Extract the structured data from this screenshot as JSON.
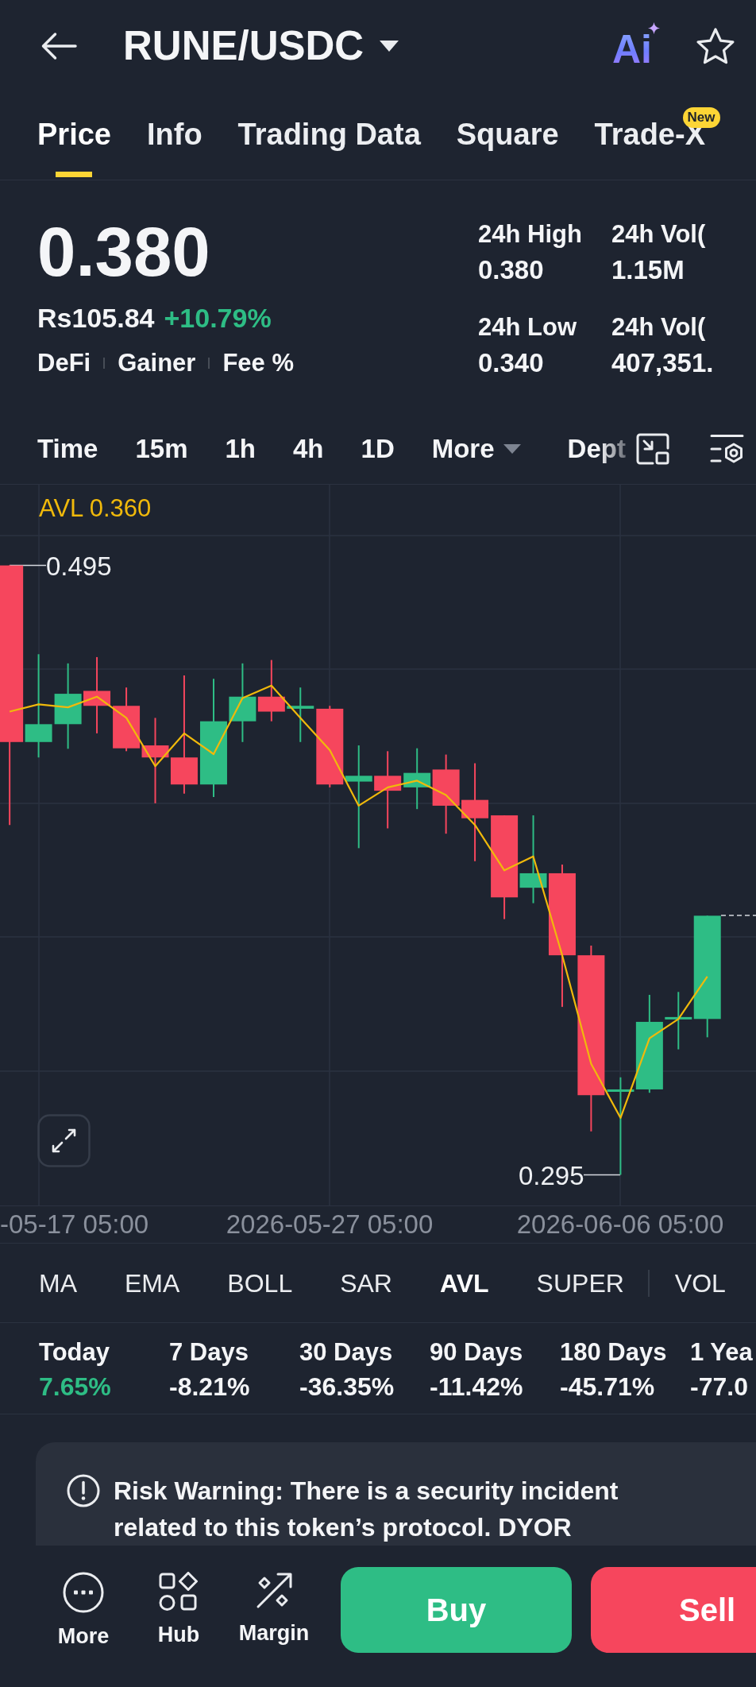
{
  "header": {
    "title": "RUNE/USDC",
    "ai_label": "Ai"
  },
  "tabs": [
    {
      "label": "Price",
      "selected": true
    },
    {
      "label": "Info",
      "selected": false
    },
    {
      "label": "Trading Data",
      "selected": false
    },
    {
      "label": "Square",
      "selected": false
    },
    {
      "label": "Trade-X",
      "selected": false,
      "badge": "New"
    }
  ],
  "price": {
    "last": "0.380",
    "fiat": "Rs105.84",
    "change": {
      "value": "+10.79%",
      "kind": "gain"
    },
    "tags": [
      "DeFi",
      "Gainer",
      "Fee %"
    ]
  },
  "stats": [
    {
      "label": "24h High",
      "value": "0.380"
    },
    {
      "label": "24h Vol(",
      "value": "1.15M"
    },
    {
      "label": "24h Low",
      "value": "0.340"
    },
    {
      "label": "24h Vol(",
      "value": "407,351."
    }
  ],
  "chart_toolbar": {
    "intervals": [
      "Time",
      "15m",
      "1h",
      "4h",
      "1D"
    ],
    "more": "More",
    "depth": "Dept"
  },
  "chart": {
    "avl_label": "AVL 0.360",
    "high_label": "0.495",
    "low_label": "0.295",
    "dates": [
      "-05-17 05:00",
      "2026-05-27 05:00",
      "2026-06-06 05:00"
    ]
  },
  "indicators": [
    {
      "label": "MA",
      "selected": false
    },
    {
      "label": "EMA",
      "selected": false
    },
    {
      "label": "BOLL",
      "selected": false
    },
    {
      "label": "SAR",
      "selected": false
    },
    {
      "label": "AVL",
      "selected": true
    },
    {
      "label": "SUPER",
      "selected": false
    },
    {
      "label": "VOL",
      "selected": false
    }
  ],
  "performance": [
    {
      "period": "Today",
      "change": "7.65%",
      "kind": "gain"
    },
    {
      "period": "7 Days",
      "change": "-8.21%",
      "kind": "loss"
    },
    {
      "period": "30 Days",
      "change": "-36.35%",
      "kind": "loss"
    },
    {
      "period": "90 Days",
      "change": "-11.42%",
      "kind": "loss"
    },
    {
      "period": "180 Days",
      "change": "-45.71%",
      "kind": "loss"
    },
    {
      "period": "1 Yea",
      "change": "-77.0",
      "kind": "loss"
    }
  ],
  "risk_warning": "Risk Warning: There is a security incident related to this token’s protocol. DYOR",
  "bottom_bar": {
    "actions": [
      "More",
      "Hub",
      "Margin"
    ],
    "buy": "Buy",
    "sell": "Sell"
  }
}
